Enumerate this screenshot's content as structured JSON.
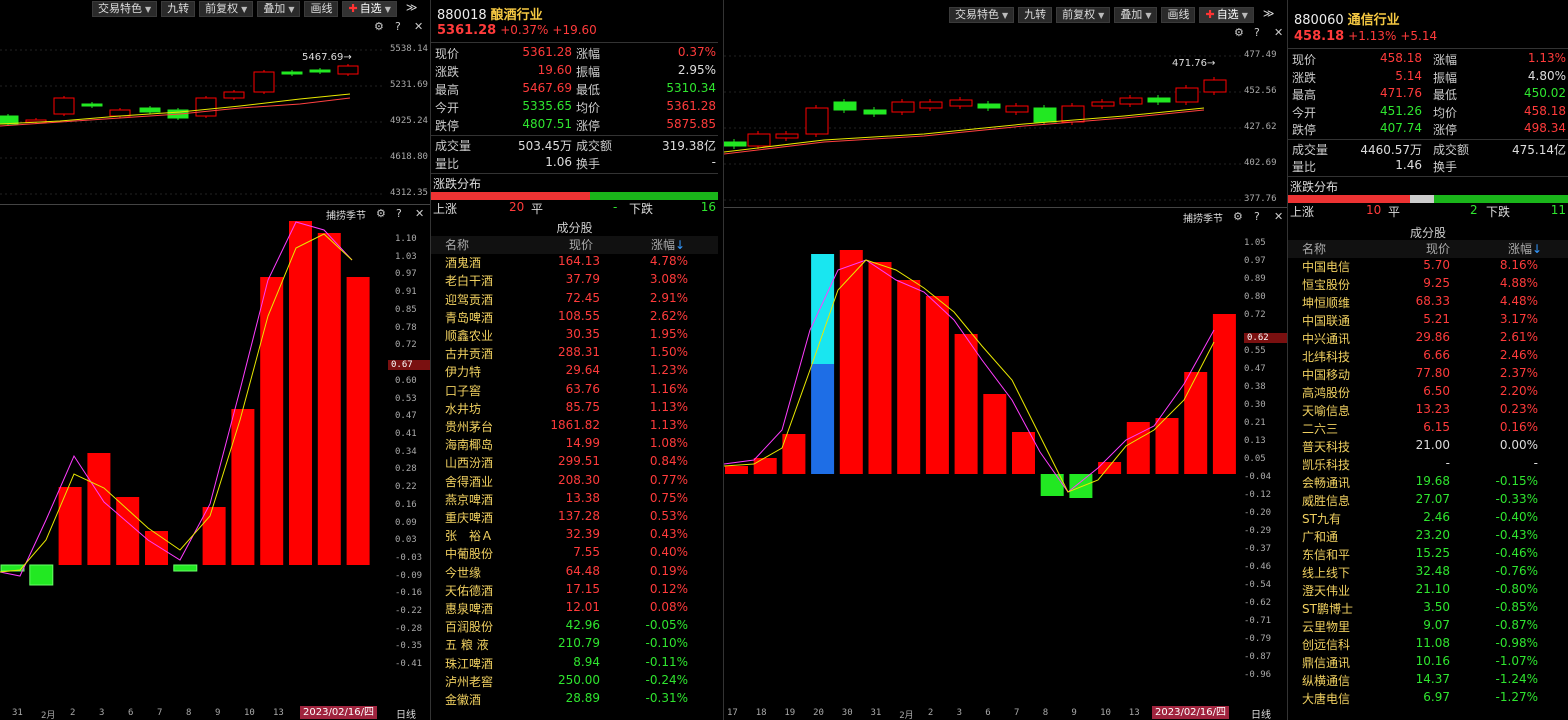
{
  "toolbar": {
    "trade_feature": "交易特色",
    "nine": "九转",
    "prev_adj": "前复权",
    "overlay": "叠加",
    "line_tool": "画线",
    "watchlist": "自选"
  },
  "left": {
    "code": "880018",
    "name": "酿酒行业",
    "price": "5361.28",
    "chg_pct": "+0.37%",
    "chg": "+19.60",
    "indicator_title": "捕捞季节",
    "daily": "日线",
    "date": "2023/02/16/四",
    "price_ticks": [
      "5538.14",
      "5231.69",
      "4925.24",
      "4618.80",
      "4312.35"
    ],
    "high_label": "5467.69",
    "osc_ticks": [
      "1.10",
      "1.03",
      "0.97",
      "0.91",
      "0.85",
      "0.78",
      "0.72",
      "0.60",
      "0.53",
      "0.47",
      "0.41",
      "0.34",
      "0.28",
      "0.22",
      "0.16",
      "0.09",
      "0.03",
      "-0.03",
      "-0.09",
      "-0.16",
      "-0.22",
      "-0.28",
      "-0.35",
      "-0.41"
    ],
    "osc_current": "0.67",
    "dates": [
      "31",
      "2月",
      "2",
      "3",
      "6",
      "7",
      "8",
      "9",
      "10",
      "13"
    ],
    "stats": {
      "xj": "现价",
      "xj_v": "5361.28",
      "zf": "涨幅",
      "zf_v": "0.37%",
      "zd": "涨跌",
      "zd_v": "19.60",
      "zhf": "振幅",
      "zhf_v": "2.95%",
      "zg": "最高",
      "zg_v": "5467.69",
      "zd2": "最低",
      "zd2_v": "5310.34",
      "jk": "今开",
      "jk_v": "5335.65",
      "jj": "均价",
      "jj_v": "5361.28",
      "dt": "跌停",
      "dt_v": "4807.51",
      "zt": "涨停",
      "zt_v": "5875.85",
      "cjl": "成交量",
      "cjl_v": "503.45万",
      "cje": "成交额",
      "cje_v": "319.38亿",
      "lb": "量比",
      "lb_v": "1.06",
      "hs": "换手",
      "hs_v": "-"
    },
    "dist": {
      "title": "涨跌分布",
      "up": "上涨",
      "up_n": "20",
      "flat": "平",
      "flat_n": "-",
      "down": "下跌",
      "down_n": "16"
    },
    "cons": {
      "title": "成分股",
      "h_name": "名称",
      "h_price": "现价",
      "h_pct": "涨幅",
      "rows": [
        [
          "酒鬼酒",
          "164.13",
          "4.78%"
        ],
        [
          "老白干酒",
          "37.79",
          "3.08%"
        ],
        [
          "迎驾贡酒",
          "72.45",
          "2.91%"
        ],
        [
          "青岛啤酒",
          "108.55",
          "2.62%"
        ],
        [
          "顺鑫农业",
          "30.35",
          "1.95%"
        ],
        [
          "古井贡酒",
          "288.31",
          "1.50%"
        ],
        [
          "伊力特",
          "29.64",
          "1.23%"
        ],
        [
          "口子窖",
          "63.76",
          "1.16%"
        ],
        [
          "水井坊",
          "85.75",
          "1.13%"
        ],
        [
          "贵州茅台",
          "1861.82",
          "1.13%"
        ],
        [
          "海南椰岛",
          "14.99",
          "1.08%"
        ],
        [
          "山西汾酒",
          "299.51",
          "0.84%"
        ],
        [
          "舍得酒业",
          "208.30",
          "0.77%"
        ],
        [
          "燕京啤酒",
          "13.38",
          "0.75%"
        ],
        [
          "重庆啤酒",
          "137.28",
          "0.53%"
        ],
        [
          "张　裕Ａ",
          "32.39",
          "0.43%"
        ],
        [
          "中葡股份",
          "7.55",
          "0.40%"
        ],
        [
          "今世缘",
          "64.48",
          "0.19%"
        ],
        [
          "天佑德酒",
          "17.15",
          "0.12%"
        ],
        [
          "惠泉啤酒",
          "12.01",
          "0.08%"
        ],
        [
          "百润股份",
          "42.96",
          "-0.05%"
        ],
        [
          "五 粮 液",
          "210.79",
          "-0.10%"
        ],
        [
          "珠江啤酒",
          "8.94",
          "-0.11%"
        ],
        [
          "泸州老窖",
          "250.00",
          "-0.24%"
        ],
        [
          "金徽酒",
          "28.89",
          "-0.31%"
        ]
      ]
    }
  },
  "right": {
    "code": "880060",
    "name": "通信行业",
    "price": "458.18",
    "chg_pct": "+1.13%",
    "chg": "+5.14",
    "indicator_title": "捕捞季节",
    "daily": "日线",
    "date": "2023/02/16/四",
    "price_ticks": [
      "477.49",
      "452.56",
      "427.62",
      "402.69",
      "377.76"
    ],
    "high_label": "471.76",
    "osc_ticks": [
      "1.05",
      "0.97",
      "0.89",
      "0.80",
      "0.72",
      "0.55",
      "0.47",
      "0.38",
      "0.30",
      "0.21",
      "0.13",
      "0.05",
      "-0.04",
      "-0.12",
      "-0.20",
      "-0.29",
      "-0.37",
      "-0.46",
      "-0.54",
      "-0.62",
      "-0.71",
      "-0.79",
      "-0.87",
      "-0.96"
    ],
    "osc_current": "0.62",
    "dates": [
      "17",
      "18",
      "19",
      "20",
      "30",
      "31",
      "2月",
      "2",
      "3",
      "6",
      "7",
      "8",
      "9",
      "10",
      "13"
    ],
    "stats": {
      "xj": "现价",
      "xj_v": "458.18",
      "zf": "涨幅",
      "zf_v": "1.13%",
      "zd": "涨跌",
      "zd_v": "5.14",
      "zhf": "振幅",
      "zhf_v": "4.80%",
      "zg": "最高",
      "zg_v": "471.76",
      "zd2": "最低",
      "zd2_v": "450.02",
      "jk": "今开",
      "jk_v": "451.26",
      "jj": "均价",
      "jj_v": "458.18",
      "dt": "跌停",
      "dt_v": "407.74",
      "zt": "涨停",
      "zt_v": "498.34",
      "cjl": "成交量",
      "cjl_v": "4460.57万",
      "cje": "成交额",
      "cje_v": "475.14亿",
      "lb": "量比",
      "lb_v": "1.46",
      "hs": "换手",
      "hs_v": ""
    },
    "dist": {
      "title": "涨跌分布",
      "up": "上涨",
      "up_n": "10",
      "flat": "平",
      "flat_n": "2",
      "down": "下跌",
      "down_n": "11"
    },
    "cons": {
      "title": "成分股",
      "h_name": "名称",
      "h_price": "现价",
      "h_pct": "涨幅",
      "rows": [
        [
          "中国电信",
          "5.70",
          "8.16%"
        ],
        [
          "恒宝股份",
          "9.25",
          "4.88%"
        ],
        [
          "坤恒顺维",
          "68.33",
          "4.48%"
        ],
        [
          "中国联通",
          "5.21",
          "3.17%"
        ],
        [
          "中兴通讯",
          "29.86",
          "2.61%"
        ],
        [
          "北纬科技",
          "6.66",
          "2.46%"
        ],
        [
          "中国移动",
          "77.80",
          "2.37%"
        ],
        [
          "高鸿股份",
          "6.50",
          "2.20%"
        ],
        [
          "天喻信息",
          "13.23",
          "0.23%"
        ],
        [
          "二六三",
          "6.15",
          "0.16%"
        ],
        [
          "普天科技",
          "21.00",
          "0.00%"
        ],
        [
          "凯乐科技",
          "-",
          "-"
        ],
        [
          "会畅通讯",
          "19.68",
          "-0.15%"
        ],
        [
          "威胜信息",
          "27.07",
          "-0.33%"
        ],
        [
          "ST九有",
          "2.46",
          "-0.40%"
        ],
        [
          "广和通",
          "23.20",
          "-0.43%"
        ],
        [
          "东信和平",
          "15.25",
          "-0.46%"
        ],
        [
          "线上线下",
          "32.48",
          "-0.76%"
        ],
        [
          "澄天伟业",
          "21.10",
          "-0.80%"
        ],
        [
          "ST鹏博士",
          "3.50",
          "-0.85%"
        ],
        [
          "云里物里",
          "9.07",
          "-0.87%"
        ],
        [
          "创远信科",
          "11.08",
          "-0.98%"
        ],
        [
          "鼎信通讯",
          "10.16",
          "-1.07%"
        ],
        [
          "纵横通信",
          "14.37",
          "-1.24%"
        ],
        [
          "大唐电信",
          "6.97",
          "-1.27%"
        ]
      ]
    }
  },
  "colors": {
    "up": "#ff0000",
    "down": "#22e822",
    "cyan": "#19e6f0",
    "blue": "#1e6ee6"
  }
}
